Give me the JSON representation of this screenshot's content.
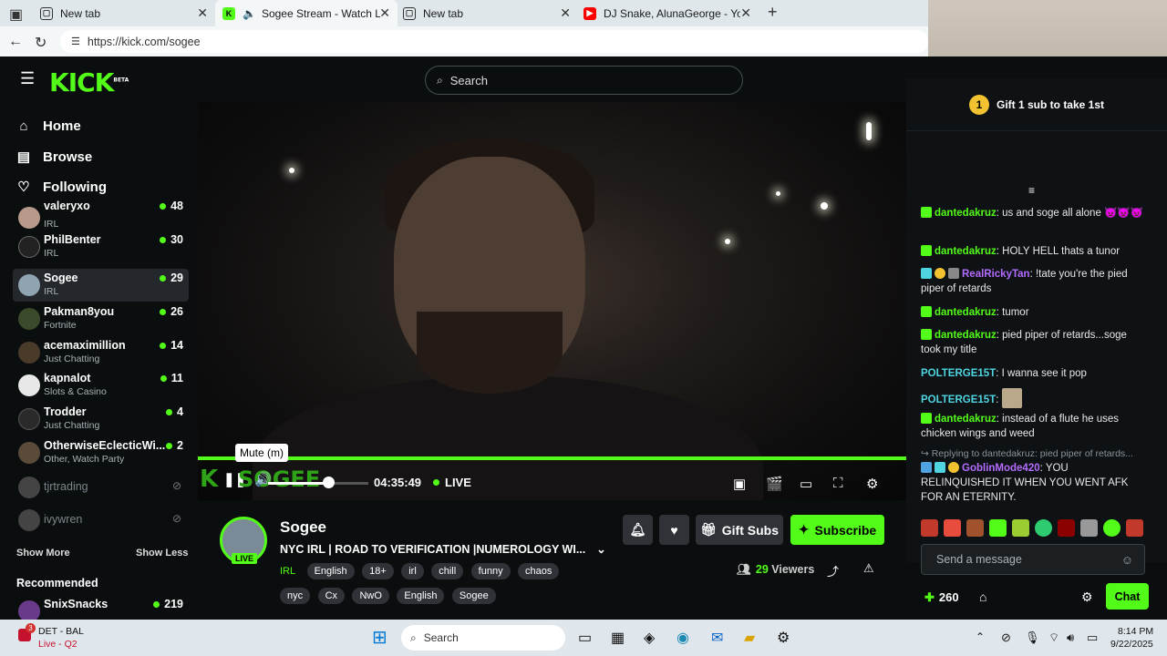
{
  "browser": {
    "tabs": [
      {
        "title": "New tab"
      },
      {
        "title": "Sogee Stream - Watch Live o"
      },
      {
        "title": "New tab"
      },
      {
        "title": "DJ Snake, AlunaGeorge - You Kno"
      }
    ],
    "url": "https://kick.com/sogee"
  },
  "header": {
    "logo": "KICK",
    "beta": "BETA",
    "search_placeholder": "Search"
  },
  "sidebar": {
    "nav": [
      {
        "label": "Home"
      },
      {
        "label": "Browse"
      },
      {
        "label": "Following"
      }
    ],
    "channels": [
      {
        "name": "valeryxo",
        "category": "IRL",
        "viewers": "48"
      },
      {
        "name": "PhilBenter",
        "category": "IRL",
        "viewers": "30"
      },
      {
        "name": "Sogee",
        "category": "IRL",
        "viewers": "29"
      },
      {
        "name": "Pakman8you",
        "category": "Fortnite",
        "viewers": "26"
      },
      {
        "name": "acemaximillion",
        "category": "Just Chatting",
        "viewers": "14"
      },
      {
        "name": "kapnalot",
        "category": "Slots & Casino",
        "viewers": "11"
      },
      {
        "name": "Trodder",
        "category": "Just Chatting",
        "viewers": "4"
      },
      {
        "name": "OtherwiseEclecticWi...",
        "category": "Other, Watch Party",
        "viewers": "2"
      },
      {
        "name": "tjrtrading",
        "category": "",
        "viewers": ""
      },
      {
        "name": "ivywren",
        "category": "",
        "viewers": ""
      }
    ],
    "show_more": "Show More",
    "show_less": "Show Less",
    "recommended_heading": "Recommended",
    "recommended": [
      {
        "name": "SnixSnacks",
        "viewers": "219"
      }
    ]
  },
  "player": {
    "tooltip": "Mute (m)",
    "elapsed": "04:35:49",
    "live": "LIVE",
    "watermark": "SOGEE"
  },
  "stream": {
    "streamer": "Sogee",
    "live_badge": "LIVE",
    "title": "NYC IRL | ROAD TO VERIFICATION |NUMEROLOGY WI...",
    "category": "IRL",
    "tags": [
      "English",
      "18+",
      "irl",
      "chill",
      "funny",
      "chaos",
      "nyc",
      "Cx",
      "NwO",
      "English",
      "Sogee"
    ],
    "gift_subs": "Gift Subs",
    "subscribe": "Subscribe",
    "viewers_count": "29",
    "viewers_label": "Viewers"
  },
  "chat": {
    "pinned_coin": "1",
    "pinned": "Gift 1 sub to take 1st",
    "messages": [
      {
        "user": "dantedakruz",
        "text": "us and soge all alone 👿👿👿",
        "color": "#53fc18"
      },
      {
        "user": "dantedakruz",
        "text": "HOLY HELL thats a tunor",
        "color": "#53fc18"
      },
      {
        "user": "RealRickyTan",
        "text": "!tate you're the pied piper of retards",
        "color": "#b36cff"
      },
      {
        "user": "dantedakruz",
        "text": "tumor",
        "color": "#53fc18"
      },
      {
        "user": "dantedakruz",
        "text": "pied piper of retards...soge took my title",
        "color": "#53fc18"
      },
      {
        "user": "POLTERGE15T",
        "text": "I wanna see it pop",
        "color": "#4fd4e0"
      },
      {
        "user": "POLTERGE15T",
        "text": "",
        "color": "#4fd4e0"
      },
      {
        "user": "dantedakruz",
        "text": "instead of a flute he uses chicken wings and weed",
        "color": "#53fc18"
      },
      {
        "user": "GoblinMode420",
        "text": "YOU RELINQUISHED IT WHEN YOU WENT AFK FOR AN ETERNITY.",
        "color": "#b36cff"
      }
    ],
    "reply_to": "Replying to dantedakruz: pied piper of retards...",
    "input_placeholder": "Send a message",
    "points": "260",
    "chat_button": "Chat"
  },
  "taskbar": {
    "weather_title": "DET - BAL",
    "weather_sub": "Live - Q2",
    "badge": "3",
    "search": "Search",
    "time": "8:14 PM",
    "date": "9/22/2025"
  }
}
